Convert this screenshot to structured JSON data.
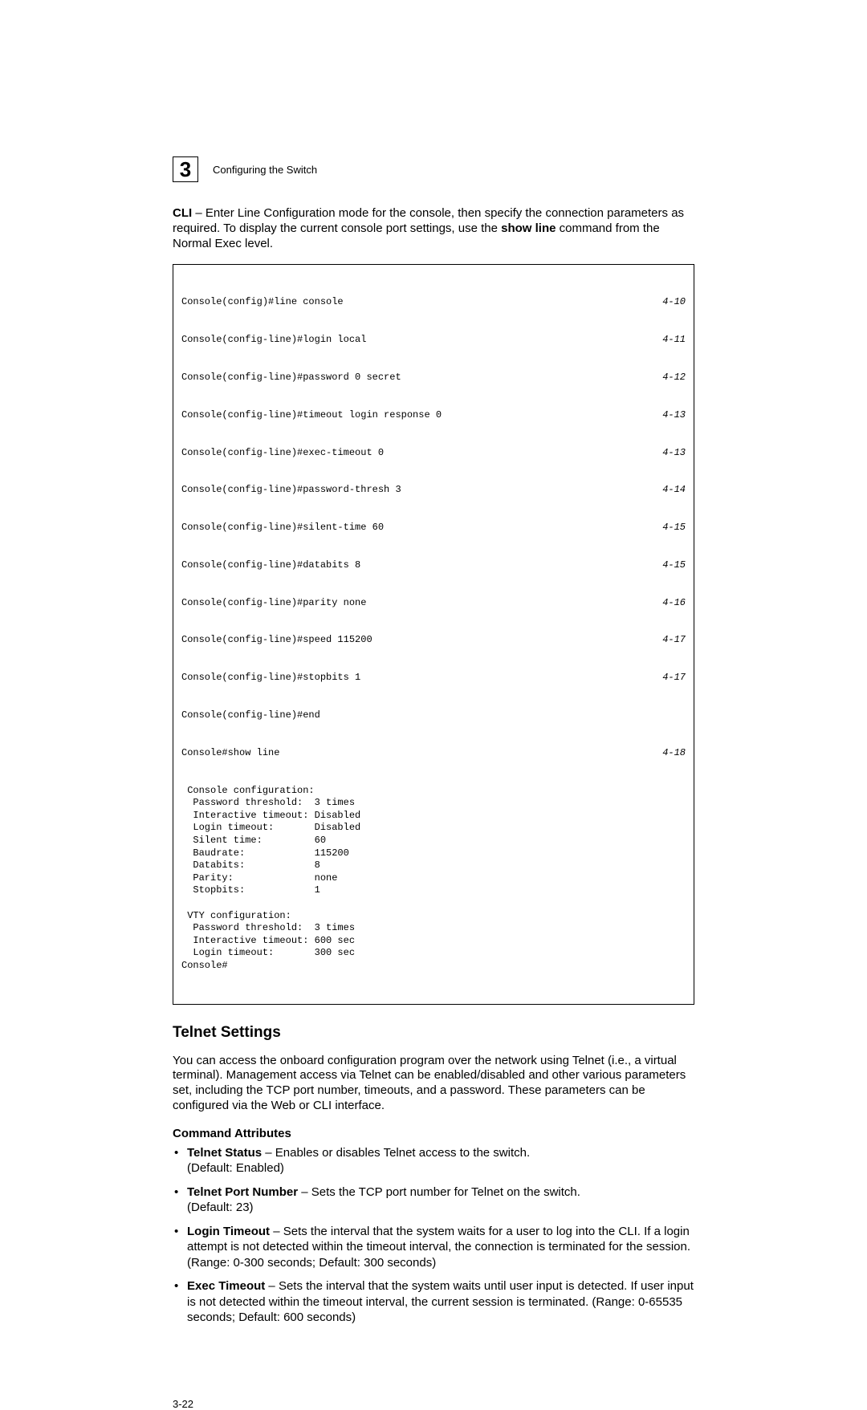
{
  "header": {
    "chapter_number": "3",
    "chapter_title": "Configuring the Switch"
  },
  "intro": {
    "pre": "CLI",
    "text": " – Enter Line Configuration mode for the console, then specify the connection parameters as required. To display the current console port settings, use the ",
    "bold_cmd": "show line",
    "post": " command from the Normal Exec level."
  },
  "code_rows": [
    {
      "cmd": "Console(config)#line console",
      "ref": "4-10"
    },
    {
      "cmd": "Console(config-line)#login local",
      "ref": "4-11"
    },
    {
      "cmd": "Console(config-line)#password 0 secret",
      "ref": "4-12"
    },
    {
      "cmd": "Console(config-line)#timeout login response 0",
      "ref": "4-13"
    },
    {
      "cmd": "Console(config-line)#exec-timeout 0",
      "ref": "4-13"
    },
    {
      "cmd": "Console(config-line)#password-thresh 3",
      "ref": "4-14"
    },
    {
      "cmd": "Console(config-line)#silent-time 60",
      "ref": "4-15"
    },
    {
      "cmd": "Console(config-line)#databits 8",
      "ref": "4-15"
    },
    {
      "cmd": "Console(config-line)#parity none",
      "ref": "4-16"
    },
    {
      "cmd": "Console(config-line)#speed 115200",
      "ref": "4-17"
    },
    {
      "cmd": "Console(config-line)#stopbits 1",
      "ref": "4-17"
    },
    {
      "cmd": "Console(config-line)#end",
      "ref": ""
    },
    {
      "cmd": "Console#show line",
      "ref": "4-18"
    }
  ],
  "code_output": " Console configuration:\n  Password threshold:  3 times\n  Interactive timeout: Disabled\n  Login timeout:       Disabled\n  Silent time:         60\n  Baudrate:            115200\n  Databits:            8\n  Parity:              none\n  Stopbits:            1\n\n VTY configuration:\n  Password threshold:  3 times\n  Interactive timeout: 600 sec\n  Login timeout:       300 sec\nConsole#",
  "section": {
    "title": "Telnet Settings",
    "para": "You can access the onboard configuration program over the network using Telnet (i.e., a virtual terminal). Management access via Telnet can be enabled/disabled and other various parameters set, including the TCP port number, timeouts, and a password. These parameters can be configured via the Web or CLI interface.",
    "attrs_heading": "Command Attributes",
    "attrs": [
      {
        "name": "Telnet Status",
        "desc": " – Enables or disables Telnet access to the switch.",
        "extra": "(Default: Enabled)"
      },
      {
        "name": "Telnet Port Number",
        "desc": " – Sets the TCP port number for Telnet on the switch.",
        "extra": "(Default: 23)"
      },
      {
        "name": "Login Timeout",
        "desc": " – Sets the interval that the system waits for a user to log into the CLI. If a login attempt is not detected within the timeout interval, the connection is terminated for the session. (Range: 0-300 seconds; Default: 300 seconds)",
        "extra": ""
      },
      {
        "name": "Exec Timeout",
        "desc": " – Sets the interval that the system waits until user input is detected. If user input is not detected within the timeout interval, the current session is terminated. (Range: 0-65535 seconds; Default: 600 seconds)",
        "extra": ""
      }
    ]
  },
  "page_number": "3-22"
}
